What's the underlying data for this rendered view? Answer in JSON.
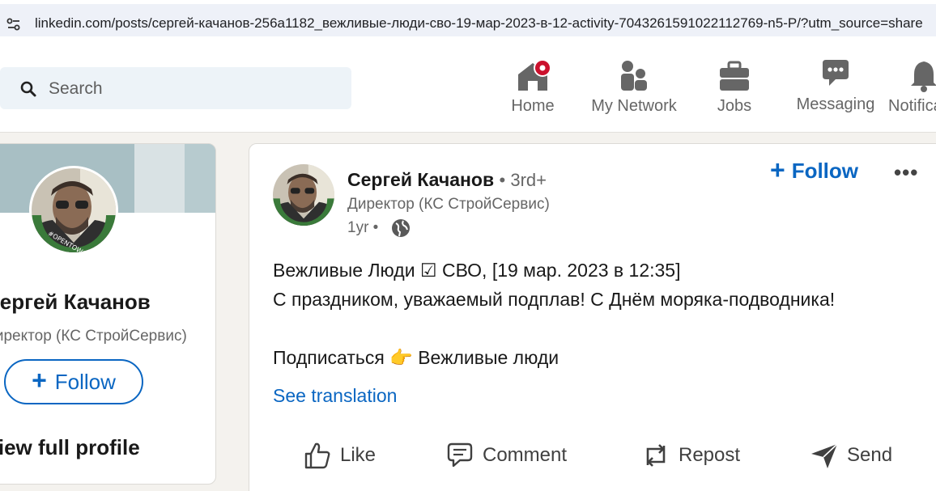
{
  "browser": {
    "url": "linkedin.com/posts/сергей-качанов-256a1182_вежливые-люди-сво-19-мар-2023-в-12-activity-7043261591022112769-n5-P/?utm_source=share"
  },
  "nav": {
    "search_placeholder": "Search",
    "items": [
      {
        "label": "Home",
        "icon": "home-icon"
      },
      {
        "label": "My Network",
        "icon": "network-icon"
      },
      {
        "label": "Jobs",
        "icon": "briefcase-icon"
      },
      {
        "label": "Messaging",
        "icon": "message-icon"
      },
      {
        "label": "Notifications",
        "icon": "bell-icon"
      }
    ],
    "badge_color": "#cb112d"
  },
  "profile_card": {
    "name": "Сергей Качанов",
    "title": "Директор (КС СтройСервис)",
    "follow_label": "Follow",
    "view_profile_label": "View full profile",
    "badge_text": "#OPENTOWORK"
  },
  "post": {
    "author": "Сергей Качанов",
    "degree": "• 3rd+",
    "headline": "Директор (КС СтройСервис)",
    "time": "1yr •",
    "follow_label": "Follow",
    "more_label": "•••",
    "lines": [
      "Вежливые Люди ☑ СВО, [19 мар. 2023 в 12:35]",
      "С праздником, уважаемый подплав! С Днём моряка-подводника!",
      "",
      "Подписаться 👉 Вежливые люди"
    ],
    "see_translation": "See translation",
    "actions": [
      {
        "label": "Like",
        "icon": "like-icon"
      },
      {
        "label": "Comment",
        "icon": "comment-icon"
      },
      {
        "label": "Repost",
        "icon": "repost-icon"
      },
      {
        "label": "Send",
        "icon": "send-icon"
      }
    ]
  },
  "colors": {
    "accent": "#0a66c2",
    "background": "#f4f2ee",
    "card": "#ffffff"
  }
}
